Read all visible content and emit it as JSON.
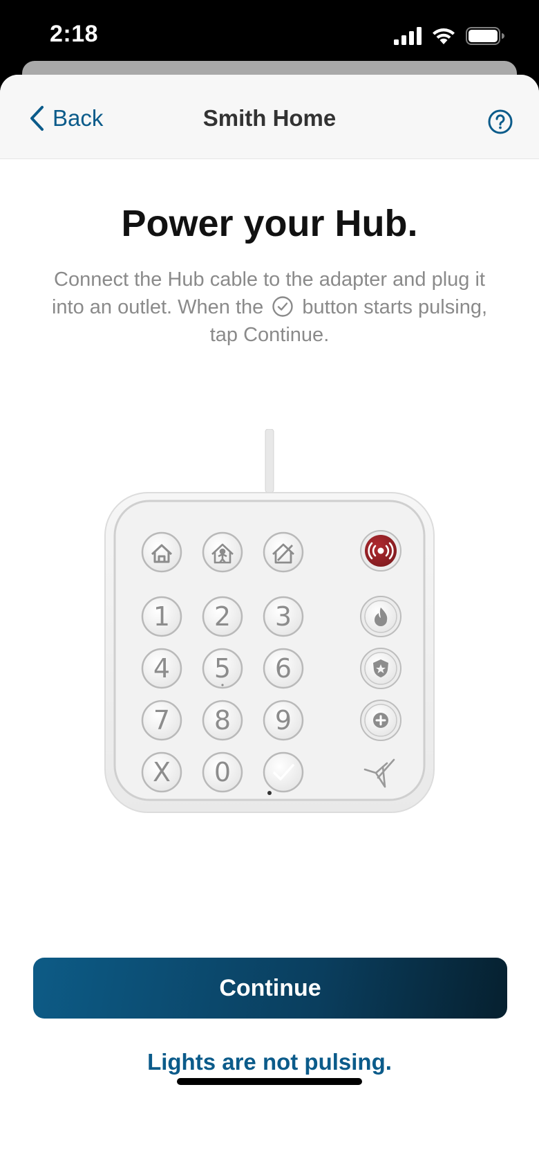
{
  "status_bar": {
    "time": "2:18",
    "icons": [
      "cellular-signal-icon",
      "wifi-icon",
      "battery-icon"
    ]
  },
  "nav": {
    "back_label": "Back",
    "title": "Smith Home",
    "help_icon": "help-circle-icon"
  },
  "content": {
    "headline": "Power your Hub.",
    "instructions_part1": "Connect the Hub cable to the adapter and plug it into an outlet. When the",
    "instructions_part2": "button starts pulsing, tap Continue."
  },
  "hub": {
    "mode_keys": [
      "home-icon",
      "home-occupied-icon",
      "away-icon"
    ],
    "panic_key": "siren-icon",
    "number_keys": [
      "1",
      "2",
      "3",
      "4",
      "5",
      "6",
      "7",
      "8",
      "9",
      "X",
      "0"
    ],
    "check_key": "check-icon",
    "emergency_keys": [
      "fire-icon",
      "police-badge-icon",
      "medical-plus-icon"
    ],
    "logo": "brand-logo-icon"
  },
  "actions": {
    "continue_label": "Continue",
    "not_pulsing_label": "Lights are not pulsing."
  },
  "colors": {
    "accent": "#0b5b8a",
    "panic_red": "#9b2226"
  }
}
